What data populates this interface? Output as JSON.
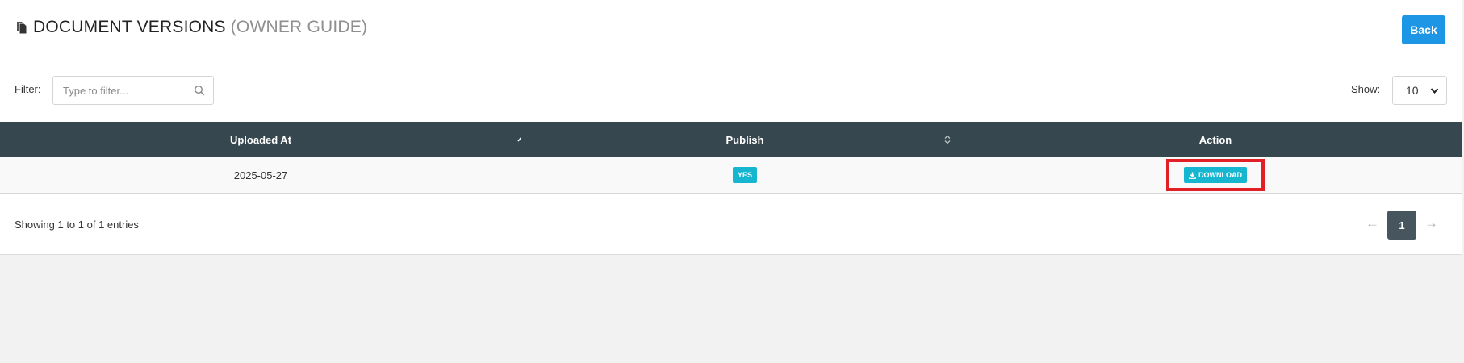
{
  "header": {
    "title": "DOCUMENT VERSIONS",
    "subtitle": "(OWNER GUIDE)",
    "back_label": "Back"
  },
  "filter": {
    "label": "Filter:",
    "placeholder": "Type to filter...",
    "value": ""
  },
  "show": {
    "label": "Show:",
    "selected": "10"
  },
  "table": {
    "columns": [
      "Uploaded At",
      "Publish",
      "Action"
    ],
    "sort": {
      "column": "Uploaded At",
      "direction": "ascending"
    },
    "rows": [
      {
        "uploaded_at": "2025-05-27",
        "publish": "YES",
        "action": "DOWNLOAD"
      }
    ]
  },
  "footer": {
    "info": "Showing 1 to 1 of 1 entries",
    "prev": "←",
    "page": "1",
    "next": "→"
  },
  "colors": {
    "header_bg": "#36474f",
    "primary_button": "#1e96e6",
    "badge": "#17b6d0",
    "highlight": "#e01f26",
    "pager_active": "#47565e"
  },
  "icons": {
    "title": "document-copy-icon",
    "filter": "search-icon",
    "sort_uploaded": "sort-up-icon",
    "sort_publish": "sort-both-icon",
    "download": "download-icon"
  }
}
